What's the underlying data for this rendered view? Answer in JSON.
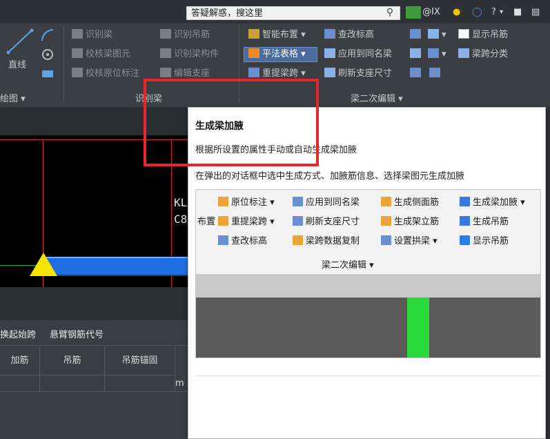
{
  "search": {
    "value": "答疑解惑，搜这里"
  },
  "topbar": {
    "user": "@IX",
    "help": "?"
  },
  "ribbon": {
    "draw": {
      "line_label": "直线",
      "group_label": "绘图"
    },
    "identify": {
      "items": [
        "识别梁",
        "识别吊筋",
        "校核梁图元",
        "识别梁构件",
        "校核原位标注",
        "编辑支座"
      ],
      "group_label": "识别梁"
    },
    "secondary": {
      "items": [
        "智能布置",
        "查改标高",
        "平法表格",
        "应用到同名梁",
        "重提梁跨",
        "刷新支座尺寸",
        "显示吊筋",
        "梁跨分类"
      ],
      "group_label": "梁二次编辑"
    }
  },
  "canvas": {
    "label_line1": "KL",
    "label_line2": "C8"
  },
  "bottom": {
    "tabs": [
      "换起始跨",
      "悬臂钢筋代号"
    ],
    "columns": [
      "加筋",
      "吊筋",
      "吊筋锚固"
    ],
    "cell": "m"
  },
  "tooltip": {
    "title": "生成梁加腋",
    "description": "根据所设置的属性手动或自动生成梁加腋",
    "instruction": "在弹出的对话框中选中生成方式、加腋筋信息、选择梁图元生成加腋",
    "preview": {
      "left_label": "布置",
      "row1": [
        "原位标注",
        "应用到同名梁",
        "生成侧面筋",
        "生成梁加腋"
      ],
      "row2": [
        "重提梁跨",
        "刷新支座尺寸",
        "生成架立筋",
        "生成吊筋"
      ],
      "row3": [
        "查改标高",
        "梁跨数据复制",
        "设置拱梁",
        "显示吊筋"
      ],
      "group_label": "梁二次编辑"
    }
  },
  "colors": {
    "highlight": "#e8262c",
    "beam": "#1e6ee0",
    "support": "#f5e400",
    "preview_green": "#29d93a"
  }
}
